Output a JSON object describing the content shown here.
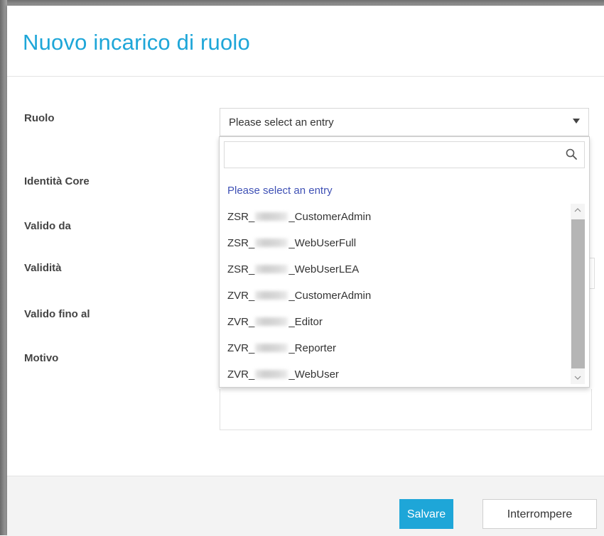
{
  "dialog": {
    "title": "Nuovo incarico di ruolo"
  },
  "form": {
    "labels": {
      "ruolo": "Ruolo",
      "identita_core": "Identità Core",
      "valido_da": "Valido da",
      "validita": "Validità",
      "valido_fino_al": "Valido fino al",
      "motivo": "Motivo"
    },
    "ruolo_select": {
      "selected_value": "Please select an entry"
    }
  },
  "dropdown": {
    "search_placeholder": "",
    "placeholder_option": "Please select an entry",
    "options": [
      {
        "prefix": "ZSR_",
        "suffix": "_CustomerAdmin"
      },
      {
        "prefix": "ZSR_",
        "suffix": "_WebUserFull"
      },
      {
        "prefix": "ZSR_",
        "suffix": "_WebUserLEA"
      },
      {
        "prefix": "ZVR_",
        "suffix": "_CustomerAdmin"
      },
      {
        "prefix": "ZVR_",
        "suffix": "_Editor"
      },
      {
        "prefix": "ZVR_",
        "suffix": "_Reporter"
      },
      {
        "prefix": "ZVR_",
        "suffix": "_WebUser"
      }
    ]
  },
  "footer": {
    "save_label": "Salvare",
    "cancel_label": "Interrompere"
  },
  "colors": {
    "accent": "#1ea6d8",
    "placeholder_option": "#3f51b5"
  }
}
